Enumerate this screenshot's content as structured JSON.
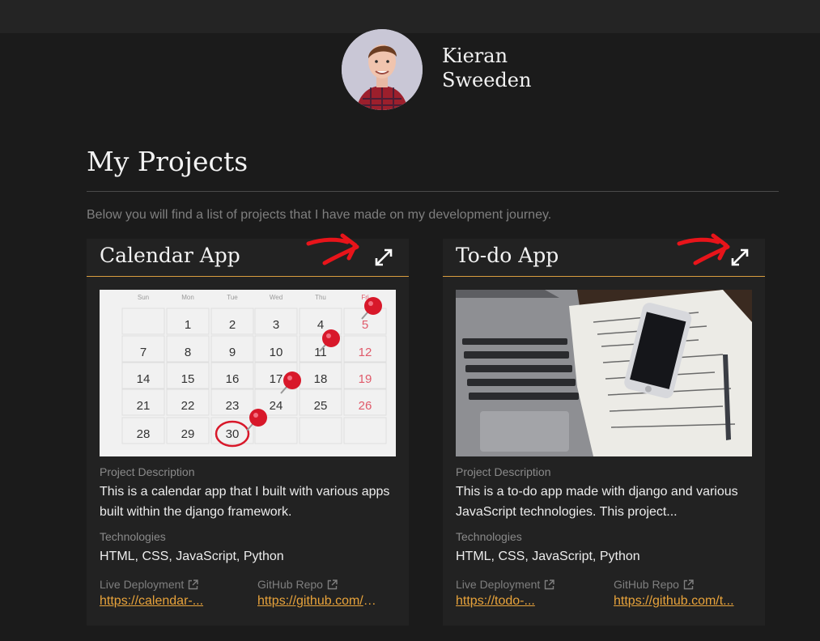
{
  "profile": {
    "name_line1": "Kieran",
    "name_line2": "Sweeden"
  },
  "page": {
    "title": "My Projects",
    "intro": "Below you will find a list of projects that I have made on my development journey."
  },
  "labels": {
    "description": "Project Description",
    "technologies": "Technologies",
    "live": "Live Deployment",
    "repo": "GitHub Repo"
  },
  "projects": [
    {
      "title": "Calendar App",
      "description": "This is a calendar app that I built with various apps built within the django framework.",
      "technologies": "HTML, CSS, JavaScript, Python",
      "live_link": "https://calendar-...",
      "repo_link": "https://github.com/c..."
    },
    {
      "title": "To-do App",
      "description": "This is a to-do app made with django and various JavaScript technologies. This project...",
      "technologies": "HTML, CSS, JavaScript, Python",
      "live_link": "https://todo-...",
      "repo_link": "https://github.com/t..."
    }
  ],
  "calendar": {
    "days": [
      "Sun",
      "Mon",
      "Tue",
      "Wed",
      "Thu",
      "Fri"
    ],
    "rows": [
      [
        "",
        "1",
        "2",
        "3",
        "4",
        "5"
      ],
      [
        "7",
        "8",
        "9",
        "10",
        "11",
        "12"
      ],
      [
        "14",
        "15",
        "16",
        "17",
        "18",
        "19"
      ],
      [
        "21",
        "22",
        "23",
        "24",
        "25",
        "26"
      ],
      [
        "28",
        "29",
        "30",
        "",
        "",
        ""
      ]
    ]
  },
  "colors": {
    "accent": "#e8a33b",
    "annotation": "#e8141a",
    "background": "#1b1b1b",
    "card": "#222222"
  },
  "icons": {
    "expand": "expand-icon",
    "external": "external-link-icon"
  }
}
